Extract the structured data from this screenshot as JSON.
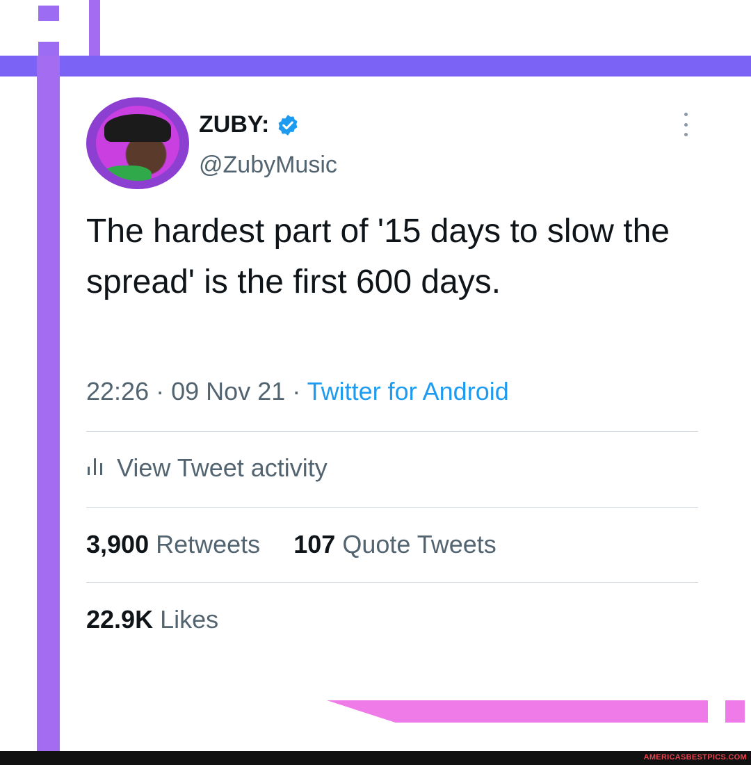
{
  "tweet": {
    "display_name": "ZUBY:",
    "handle": "@ZubyMusic",
    "text": "The hardest part of '15 days to slow the spread' is the first 600 days.",
    "time": "22:26",
    "date": "09 Nov 21",
    "separator": "·",
    "source": "Twitter for Android",
    "activity_label": "View Tweet activity",
    "retweets_count": "3,900",
    "retweets_label": "Retweets",
    "quotes_count": "107",
    "quotes_label": "Quote Tweets",
    "likes_count": "22.9K",
    "likes_label": "Likes"
  },
  "icons": {
    "verified": "verified-badge-icon",
    "more": "more-options-icon",
    "activity": "bar-chart-icon"
  },
  "colors": {
    "link": "#1d9bf0",
    "secondary_text": "#536471",
    "frame_purple": "#7b63f5",
    "frame_pink": "#ef7be8"
  },
  "watermark": "AMERICASBESTPICS.COM"
}
